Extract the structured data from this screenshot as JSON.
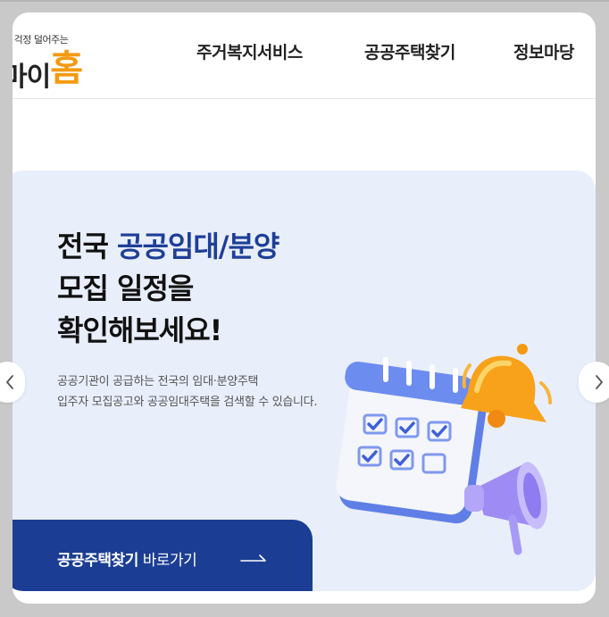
{
  "header": {
    "logo": {
      "tagline": "집 걱정 덜어주는",
      "name_part": "마이",
      "name_accent": "홈"
    },
    "nav": [
      "주거복지서비스",
      "공공주택찾기",
      "정보마당"
    ]
  },
  "hero": {
    "headline": {
      "line1_prefix": "전국 ",
      "line1_highlight": "공공임대/분양",
      "line2": "모집 일정을",
      "line3": "확인해보세요!"
    },
    "description": [
      "공공기관이 공급하는 전국의 임대·분양주택",
      "입주자 모집공고와 공공임대주택을 검색할 수 있습니다."
    ],
    "cta": {
      "bold": "공공주택찾기",
      "normal": "바로가기"
    }
  },
  "carousel": {
    "prev_icon": "chevron-left-icon",
    "next_icon": "chevron-right-icon"
  },
  "colors": {
    "accent": "#f39a12",
    "brand_blue": "#1b3e94",
    "highlight": "#1e3f97",
    "hero_bg": "#e9eefb"
  }
}
